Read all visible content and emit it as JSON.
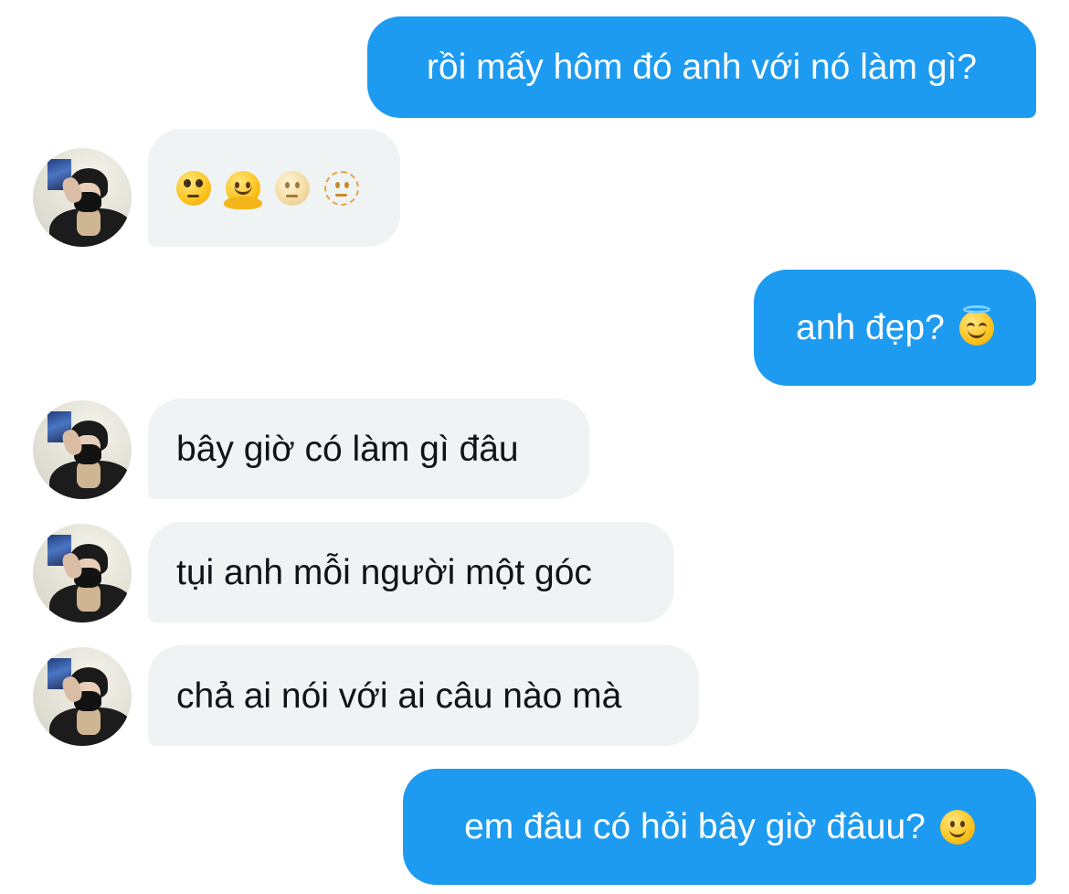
{
  "conversation": {
    "messages": [
      {
        "direction": "outgoing",
        "text": "rồi mấy hôm đó anh với nó làm gì?"
      },
      {
        "direction": "incoming",
        "text": "",
        "emojis": [
          "face-with-rolling-eyes-emoji",
          "melting-face-emoji",
          "face-in-clouds-emoji",
          "dotted-line-face-emoji"
        ]
      },
      {
        "direction": "outgoing",
        "text": "anh đẹp?",
        "emojis": [
          "smiling-face-with-halo-emoji"
        ]
      },
      {
        "direction": "incoming",
        "text": "bây giờ có làm gì đâu"
      },
      {
        "direction": "incoming",
        "text": "tụi anh mỗi người một góc"
      },
      {
        "direction": "incoming",
        "text": "chả ai nói với ai câu nào mà"
      },
      {
        "direction": "outgoing",
        "text": "em đâu có hỏi bây giờ đâuu?",
        "emojis": [
          "slightly-smiling-face-emoji"
        ]
      }
    ]
  },
  "colors": {
    "outgoing_bubble": "#1d9bf0",
    "incoming_bubble": "#eff3f4",
    "outgoing_text": "#ffffff",
    "incoming_text": "#0f1419",
    "background": "#ffffff"
  }
}
